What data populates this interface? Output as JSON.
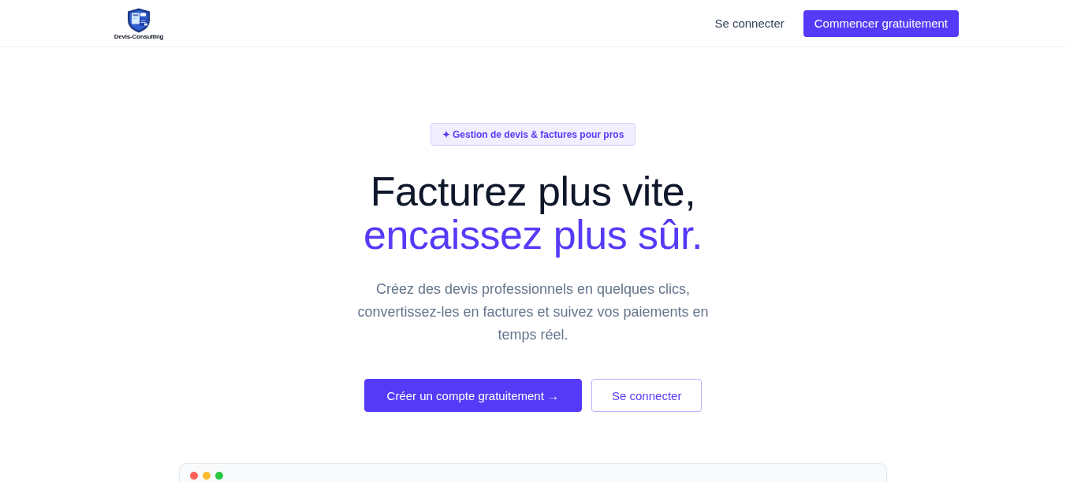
{
  "header": {
    "logo": {
      "name": "Devis-Consulting"
    },
    "nav": [
      {
        "label": "Se connecter",
        "kind": "link"
      },
      {
        "label": "Commencer gratuitement",
        "kind": "primary"
      }
    ]
  },
  "hero": {
    "badge": "✦ Gestion de devis & factures pour pros",
    "title": [
      {
        "text": "Facturez plus vite,",
        "kind": "plain"
      },
      {
        "text": "encaissez plus sûr.",
        "kind": "accent"
      }
    ],
    "subtitle": "Créez des devis professionnels en quelques clics, convertissez-les en factures et suivez vos paiements en temps réel.",
    "actions": [
      {
        "label": "Créer un compte gratuitement →",
        "kind": "primary"
      },
      {
        "label": "Se connecter",
        "kind": "outline"
      }
    ]
  },
  "preview": {
    "window_controls": [
      {
        "color": "#ff5f57"
      },
      {
        "color": "#febc2e"
      },
      {
        "color": "#28c840"
      }
    ]
  }
}
